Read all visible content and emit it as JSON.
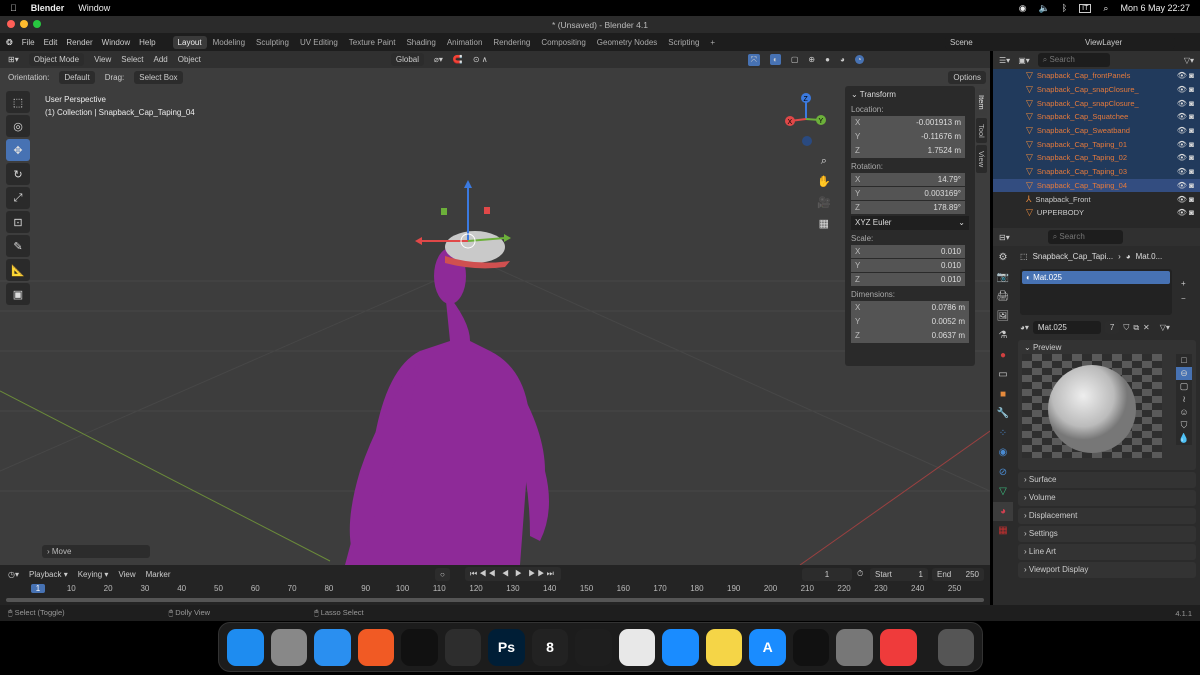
{
  "macos": {
    "app": "Blender",
    "menu": "Window",
    "clock": "Mon 6 May  22:27",
    "input": "IT"
  },
  "window": {
    "title": "* (Unsaved) - Blender 4.1"
  },
  "topbar": {
    "menus": [
      "File",
      "Edit",
      "Render",
      "Window",
      "Help"
    ],
    "workspaces": [
      "Layout",
      "Modeling",
      "Sculpting",
      "UV Editing",
      "Texture Paint",
      "Shading",
      "Animation",
      "Rendering",
      "Compositing",
      "Geometry Nodes",
      "Scripting"
    ],
    "active_workspace": "Layout",
    "add": "+",
    "scene": "Scene",
    "view_layer": "ViewLayer"
  },
  "viewport": {
    "mode": "Object Mode",
    "menus": [
      "View",
      "Select",
      "Add",
      "Object"
    ],
    "transform_orientation": "Global",
    "orientation_label": "Orientation:",
    "orientation": "Default",
    "drag_label": "Drag:",
    "drag": "Select Box",
    "options": "Options",
    "overlay_title": "User Perspective",
    "overlay_sub": "(1) Collection | Snapback_Cap_Taping_04",
    "last_op": "Move",
    "gizmo": {
      "x": "X",
      "y": "Y",
      "z": "Z"
    }
  },
  "npanel": {
    "header": "Transform",
    "location_label": "Location:",
    "location": [
      "-0.001913 m",
      "-0.11676 m",
      "1.7524 m"
    ],
    "rotation_label": "Rotation:",
    "rotation": [
      "14.79°",
      "0.003169°",
      "178.89°"
    ],
    "rotation_mode": "XYZ Euler",
    "scale_label": "Scale:",
    "scale": [
      "0.010",
      "0.010",
      "0.010"
    ],
    "dimensions_label": "Dimensions:",
    "dimensions": [
      "0.0786 m",
      "0.0052 m",
      "0.0637 m"
    ],
    "axes": [
      "X",
      "Y",
      "Z"
    ],
    "tabs": [
      "Item",
      "Tool",
      "View"
    ]
  },
  "outliner": {
    "search_placeholder": "Search",
    "items": [
      {
        "name": "Snapback_Cap_frontPanels",
        "state": "sel"
      },
      {
        "name": "Snapback_Cap_snapClosure_",
        "state": "sel"
      },
      {
        "name": "Snapback_Cap_snapClosure_",
        "state": "sel"
      },
      {
        "name": "Snapback_Cap_Squatchee",
        "state": "sel"
      },
      {
        "name": "Snapback_Cap_Sweatband",
        "state": "sel"
      },
      {
        "name": "Snapback_Cap_Taping_01",
        "state": "sel"
      },
      {
        "name": "Snapback_Cap_Taping_02",
        "state": "sel"
      },
      {
        "name": "Snapback_Cap_Taping_03",
        "state": "sel"
      },
      {
        "name": "Snapback_Cap_Taping_04",
        "state": "act"
      },
      {
        "name": "Snapback_Front",
        "state": "white"
      },
      {
        "name": "UPPERBODY",
        "state": "white"
      }
    ]
  },
  "properties": {
    "search_placeholder": "Search",
    "breadcrumb_object": "Snapback_Cap_Tapi...",
    "breadcrumb_material": "Mat.0...",
    "slot": "Mat.025",
    "material_name": "Mat.025",
    "users": "7",
    "preview": "Preview",
    "panels": [
      "Surface",
      "Volume",
      "Displacement",
      "Settings",
      "Line Art",
      "Viewport Display"
    ]
  },
  "timeline": {
    "menus": [
      "Playback",
      "Keying",
      "View",
      "Marker"
    ],
    "current_frame": "1",
    "start_label": "Start",
    "start": "1",
    "end_label": "End",
    "end": "250",
    "ticks": [
      "1",
      "10",
      "20",
      "30",
      "40",
      "50",
      "60",
      "70",
      "80",
      "90",
      "100",
      "110",
      "120",
      "130",
      "140",
      "150",
      "160",
      "170",
      "180",
      "190",
      "200",
      "210",
      "220",
      "230",
      "240",
      "250"
    ]
  },
  "status": {
    "items": [
      "Select (Toggle)",
      "Dolly View",
      "Lasso Select"
    ],
    "version": "4.1.1"
  },
  "dock": {
    "apps": [
      {
        "name": "finder",
        "color": "#1e8cf0"
      },
      {
        "name": "launchpad",
        "color": "#888"
      },
      {
        "name": "safari",
        "color": "#2a8ff0"
      },
      {
        "name": "brave",
        "color": "#f15a24"
      },
      {
        "name": "opera",
        "color": "#111"
      },
      {
        "name": "blender",
        "color": "#2d2d2d"
      },
      {
        "name": "photoshop",
        "color": "#001e36",
        "label": "Ps"
      },
      {
        "name": "rhino",
        "color": "#222",
        "label": "8"
      },
      {
        "name": "figma",
        "color": "#1e1e1e"
      },
      {
        "name": "pixelmator",
        "color": "#e8e8e8"
      },
      {
        "name": "mail",
        "color": "#1a8cff"
      },
      {
        "name": "notes",
        "color": "#f5d547"
      },
      {
        "name": "app-store",
        "color": "#1a8cff",
        "label": "A"
      },
      {
        "name": "activity-monitor",
        "color": "#111"
      },
      {
        "name": "system-settings",
        "color": "#777"
      },
      {
        "name": "anydesk",
        "color": "#ef3b3b"
      },
      {
        "name": "trash",
        "color": "#555"
      }
    ]
  }
}
